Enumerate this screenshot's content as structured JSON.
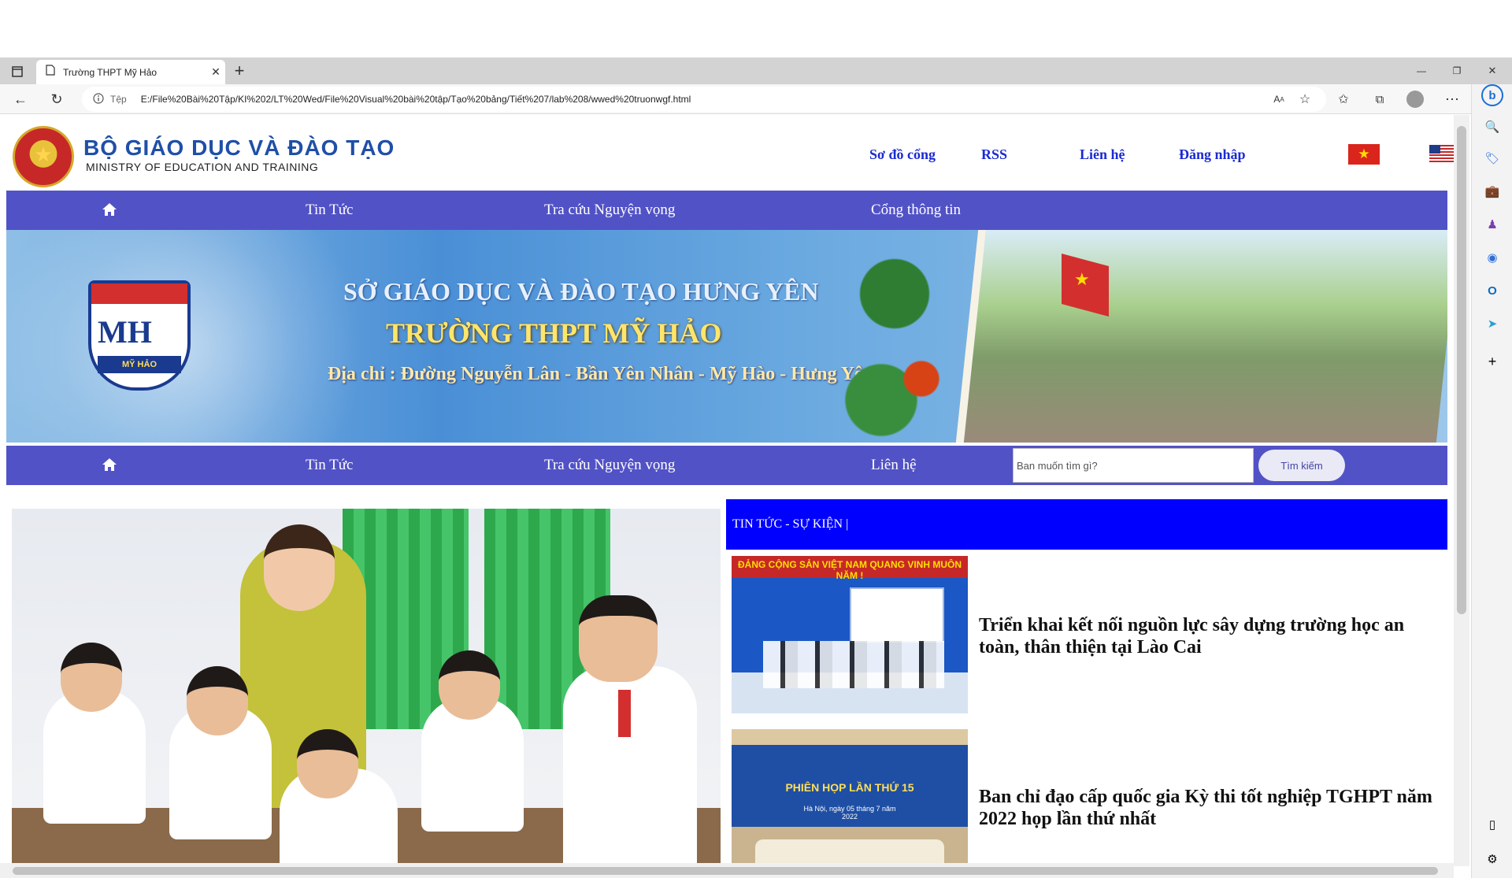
{
  "browser": {
    "tab_title": "Trường THPT Mỹ Hảo",
    "tab_close": "✕",
    "new_tab": "+",
    "url_prefix": "Tệp",
    "url": "E:/File%20Bài%20Tập/KI%202/LT%20Wed/File%20Visual%20bài%20tập/Tạo%20bảng/Tiết%207/lab%208/wwed%20truonwgf.html",
    "reader_icon": "A‍ᴬ",
    "window_minimize": "—",
    "window_restore": "❐",
    "window_close": "✕"
  },
  "header": {
    "ministry_title": "BỘ GIÁO DỤC VÀ ĐÀO TẠO",
    "ministry_subtitle": "MINISTRY OF EDUCATION AND TRAINING",
    "links": {
      "sitemap": "Sơ đồ cổng",
      "rss": "RSS",
      "contact": "Liên hệ",
      "login": "Đăng nhập"
    }
  },
  "nav_top": {
    "news": "Tin Tức",
    "aspiration": "Tra cứu Nguyện vọng",
    "portal": "Cổng thông tin"
  },
  "banner": {
    "line1": "SỞ GIÁO DỤC VÀ ĐÀO TẠO HƯNG YÊN",
    "line2": "TRƯỜNG THPT MỸ HẢO",
    "line3": "Địa chỉ : Đường Nguyễn Lân - Bần Yên Nhân - Mỹ Hào - Hưng Yên",
    "logo_text": "MH",
    "logo_band": "MỸ HẢO"
  },
  "nav_bottom": {
    "news": "Tin Tức",
    "aspiration": "Tra cứu Nguyện vọng",
    "contact": "Liên hệ",
    "search_placeholder": "Ban muốn tìm gì?",
    "search_button": "Tìm kiếm"
  },
  "news": {
    "header": "TIN TỨC - SỰ KIỆN |",
    "items": [
      {
        "title": "Triển khai kết nối nguồn lực sây dựng trường học an toàn, thân thiện tại Lào Cai",
        "thumb_banner": "ĐẢNG CỘNG SẢN VIỆT NAM QUANG VINH MUÔN NĂM !"
      },
      {
        "title": "Ban chỉ đạo cấp quốc gia Kỳ thi tốt nghiệp TGHPT năm 2022 họp lần thứ nhất",
        "thumb_screen_title": "PHIÊN HỌP LẦN THỨ 15",
        "thumb_screen_sub": "Hà Nội, ngày 05 tháng 7 năm 2022"
      }
    ]
  },
  "colors": {
    "nav_bg": "#5252c7",
    "news_header_bg": "#0000ff",
    "link_color": "#1b2bd1",
    "ministry_blue": "#1f4fa8"
  }
}
